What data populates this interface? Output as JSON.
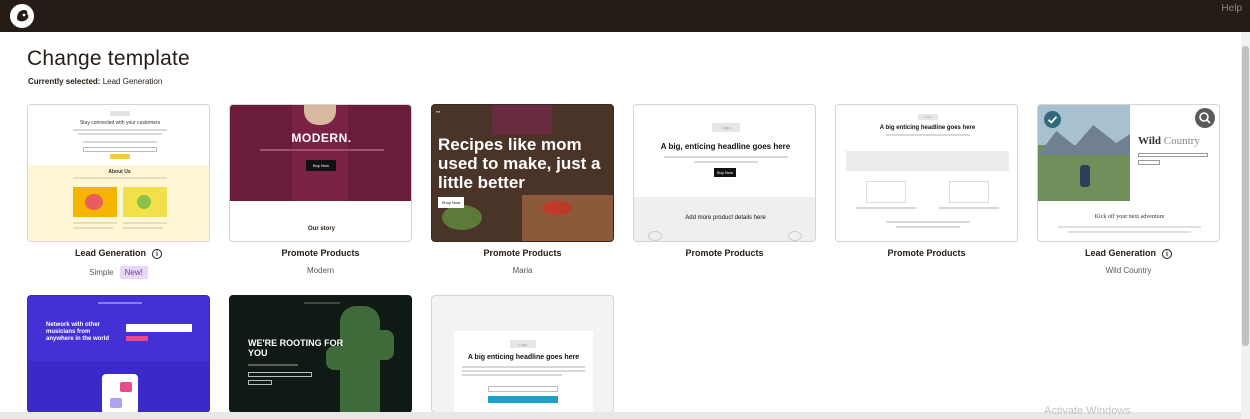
{
  "header": {
    "help_label": "Help",
    "logo_icon": "mailchimp-logo-icon"
  },
  "page": {
    "title": "Change template",
    "currently_selected_label": "Currently selected:",
    "currently_selected_value": "Lead Generation"
  },
  "templates": [
    {
      "label": "Lead Generation",
      "sub": "Simple",
      "badge": "New!",
      "info": "i",
      "preview": {
        "headline": "Stay connected with your customers",
        "about": "About Us"
      }
    },
    {
      "label": "Promote Products",
      "sub": "Modern",
      "preview": {
        "brand": "MODERN.",
        "button": "Buy Now",
        "story": "Our story"
      }
    },
    {
      "label": "Promote Products",
      "sub": "Maria",
      "preview": {
        "headline": "Recipes like mom used to make, just a little better",
        "button": "Shop Now"
      }
    },
    {
      "label": "Promote Products",
      "preview": {
        "logo": "Logo",
        "headline": "A big, enticing headline goes here",
        "button": "Buy Now",
        "details": "Add more product details here"
      }
    },
    {
      "label": "Promote Products",
      "preview": {
        "logo": "Logo",
        "headline": "A big enticing headline goes here"
      }
    },
    {
      "label": "Lead Generation",
      "sub": "Wild Country",
      "info": "i",
      "preview": {
        "title_bold": "Wild",
        "title_rest": "Country",
        "kicker": "Kick off your next adventure"
      }
    },
    {
      "preview": {
        "headline": "Network with other musicians from anywhere in the world"
      }
    },
    {
      "preview": {
        "headline": "WE'RE ROOTING FOR YOU"
      }
    },
    {
      "preview": {
        "logo": "Logo",
        "headline": "A big enticing headline goes here"
      }
    }
  ],
  "overlay": {
    "activate_windows": "Activate Windows"
  },
  "colors": {
    "topbar": "#241c15",
    "badge_bg": "#e9d7f7",
    "check": "#2f6b7c"
  }
}
